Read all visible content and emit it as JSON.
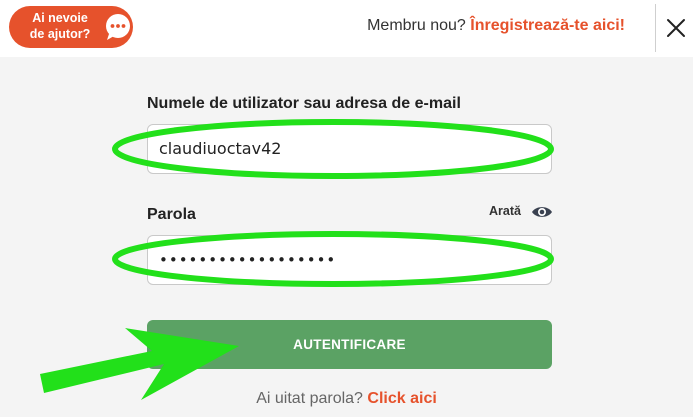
{
  "header": {
    "help_label": "Ai nevoie\nde ajutor?",
    "member_question": "Membru nou?",
    "register_link": "Înregistrează-te aici!"
  },
  "form": {
    "username_label": "Numele de utilizator sau adresa de e-mail",
    "username_value": "claudiuoctav42",
    "password_label": "Parola",
    "show_password_label": "Arată",
    "password_value": "••••••••••••••••••",
    "submit_label": "AUTENTIFICARE",
    "forgot_question": "Ai uitat parola?",
    "forgot_link": "Click aici"
  },
  "colors": {
    "accent": "#e6522c",
    "submit": "#5ba264",
    "highlight": "#22e01a"
  },
  "icons": {
    "help": "chat-bubble-icon",
    "close": "close-icon",
    "show": "eye-icon"
  }
}
